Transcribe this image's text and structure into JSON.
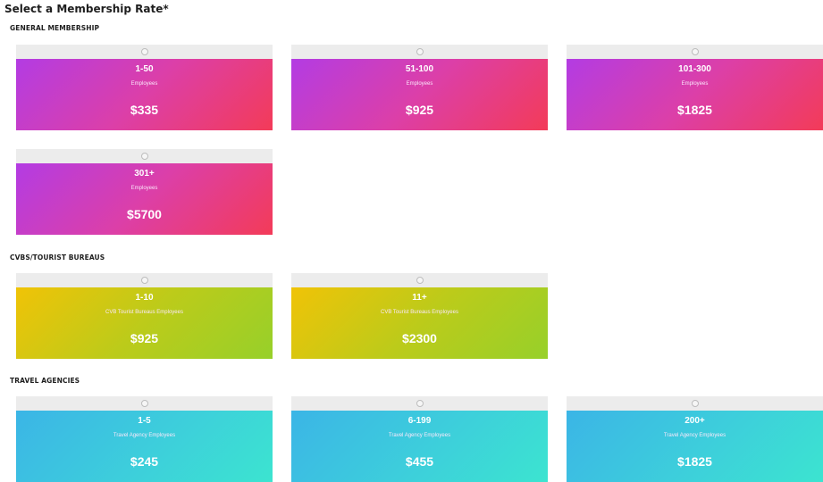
{
  "page_title": "Select a Membership Rate*",
  "sections": [
    {
      "title": "GENERAL MEMBERSHIP",
      "cards": [
        {
          "range": "1-50",
          "desc": "Employees",
          "price": "$335"
        },
        {
          "range": "51-100",
          "desc": "Employees",
          "price": "$925"
        },
        {
          "range": "101-300",
          "desc": "Employees",
          "price": "$1825"
        },
        {
          "range": "301+",
          "desc": "Employees",
          "price": "$5700"
        }
      ]
    },
    {
      "title": "CVBS/TOURIST BUREAUS",
      "cards": [
        {
          "range": "1-10",
          "desc": "CVB Tourist Bureaus Employees",
          "price": "$925"
        },
        {
          "range": "11+",
          "desc": "CVB Tourist Bureaus Employees",
          "price": "$2300"
        }
      ]
    },
    {
      "title": "TRAVEL AGENCIES",
      "cards": [
        {
          "range": "1-5",
          "desc": "Travel Agency Employees",
          "price": "$245"
        },
        {
          "range": "6-199",
          "desc": "Travel Agency Employees",
          "price": "$455"
        },
        {
          "range": "200+",
          "desc": "Travel Agency Employees",
          "price": "$1825"
        }
      ]
    }
  ],
  "colors": {
    "general": [
      "#b33ce3",
      "#f33b58"
    ],
    "cvb": [
      "#f0c307",
      "#97d02a"
    ],
    "travel": [
      "#3bb5e6",
      "#3ce4d0"
    ]
  }
}
